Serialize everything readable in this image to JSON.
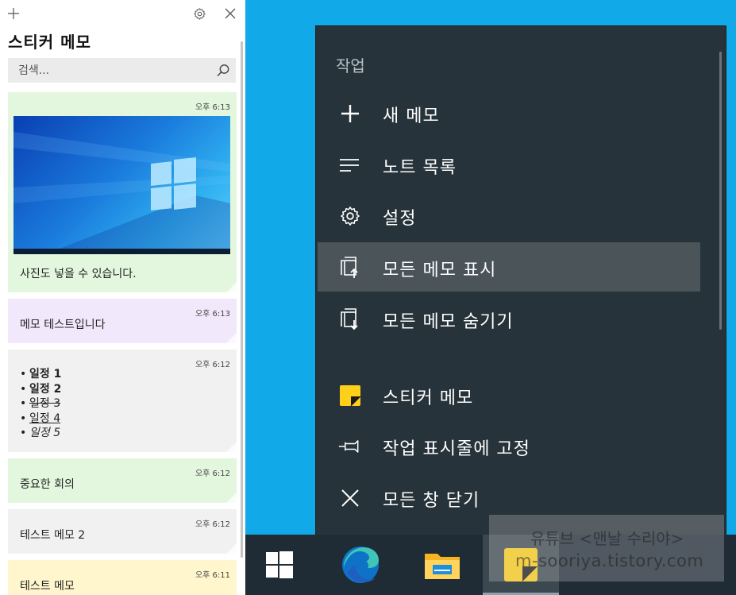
{
  "sticky_app": {
    "title": "스티커 메모",
    "search_placeholder": "검색...",
    "notes": [
      {
        "time": "오후 6:13",
        "text": "사진도 넣을 수 있습니다."
      },
      {
        "time": "오후 6:13",
        "text": "메모 테스트입니다"
      },
      {
        "time": "오후 6:12",
        "items": [
          {
            "bullet": "•",
            "text": "일정 1"
          },
          {
            "bullet": "•",
            "text": "일정 2"
          },
          {
            "bullet": "•",
            "text": "일정 3"
          },
          {
            "bullet": "•",
            "text": "일정 4"
          },
          {
            "bullet": "•",
            "text": "일정 5"
          }
        ]
      },
      {
        "time": "오후 6:12",
        "text": "중요한 회의"
      },
      {
        "time": "오후 6:12",
        "text": "테스트 메모 2"
      },
      {
        "time": "오후 6:11",
        "text": "테스트 메모"
      }
    ]
  },
  "jump_list": {
    "heading": "작업",
    "items": [
      {
        "label": "새 메모",
        "icon": "plus-icon"
      },
      {
        "label": "노트 목록",
        "icon": "list-icon"
      },
      {
        "label": "설정",
        "icon": "gear-icon"
      },
      {
        "label": "모든 메모 표시",
        "icon": "show-all-icon",
        "highlighted": true
      },
      {
        "label": "모든 메모 숨기기",
        "icon": "hide-all-icon"
      },
      {
        "label": "스티커 메모",
        "icon": "sticky-notes-app-icon"
      },
      {
        "label": "작업 표시줄에 고정",
        "icon": "pin-icon"
      },
      {
        "label": "모든 창 닫기",
        "icon": "close-icon"
      }
    ]
  },
  "taskbar": {
    "apps": [
      "windows-start-icon",
      "edge-icon",
      "file-explorer-icon",
      "sticky-notes-icon"
    ]
  },
  "watermark": {
    "line1": "유튜브 <맨날 수리야>",
    "line2": "m-sooriya.tistory.com"
  },
  "colors": {
    "desktop": "#12a9e8",
    "jump_list_bg": "#27333a",
    "highlight": "#4a5459",
    "taskbar": "#1f2c36"
  }
}
